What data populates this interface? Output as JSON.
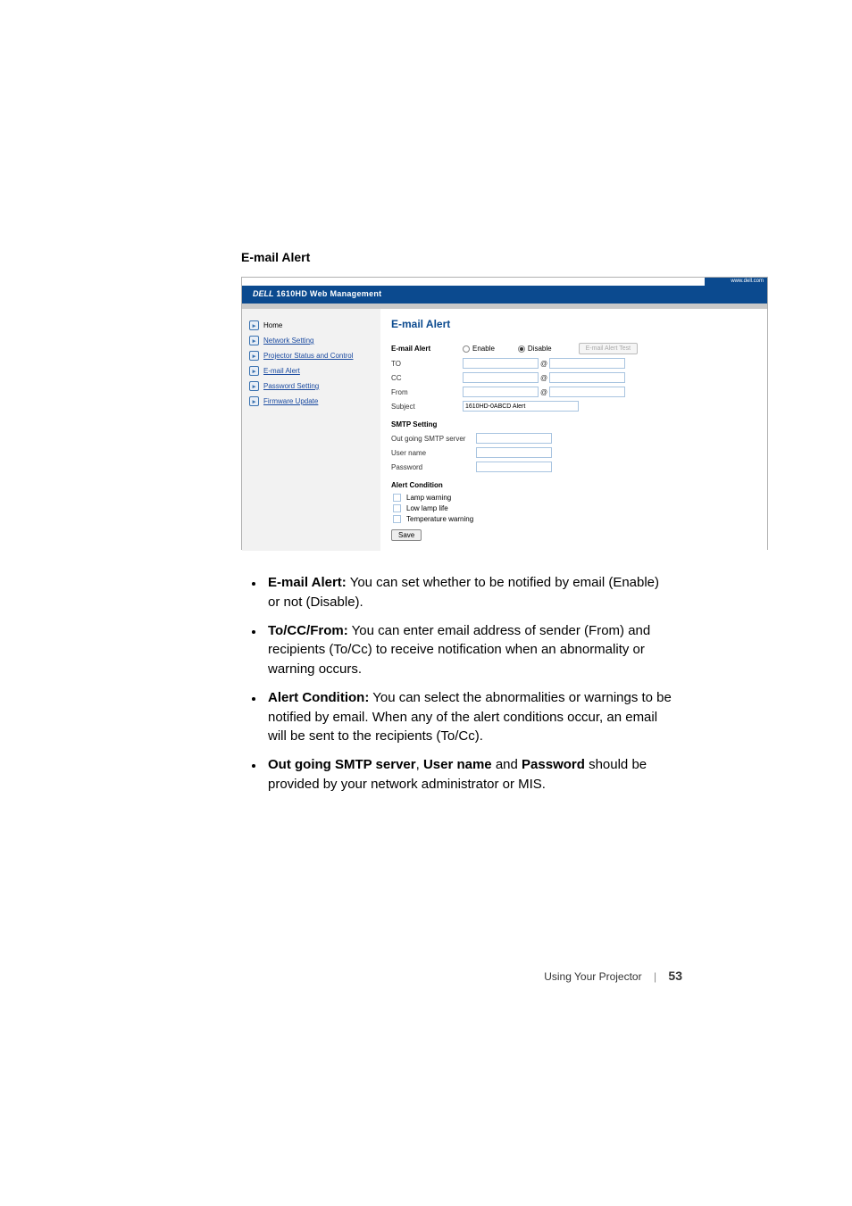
{
  "section_title": "E-mail Alert",
  "top_link": "www.dell.com",
  "header_brand": "DELL",
  "header_title": "1610HD Web Management",
  "nav": [
    {
      "label": "Home",
      "active": true
    },
    {
      "label": "Network Setting",
      "active": false
    },
    {
      "label": "Projector Status and Control",
      "active": false
    },
    {
      "label": "E-mail Alert",
      "active": false
    },
    {
      "label": "Password Setting",
      "active": false
    },
    {
      "label": "Firmware Update",
      "active": false
    }
  ],
  "panel": {
    "title": "E-mail Alert",
    "alert_label": "E-mail Alert",
    "enable": "Enable",
    "disable": "Disable",
    "test_btn": "E-mail Alert Test",
    "to": "TO",
    "cc": "CC",
    "from": "From",
    "subject": "Subject",
    "subject_value": "1610HD-0ABCD Alert",
    "smtp_head": "SMTP Setting",
    "smtp_server": "Out going SMTP server",
    "user": "User name",
    "pass": "Password",
    "cond_head": "Alert Condition",
    "c1": "Lamp warning",
    "c2": "Low lamp life",
    "c3": "Temperature warning",
    "save": "Save"
  },
  "bullets": [
    {
      "bold": "E-mail Alert:",
      "text": " You can set whether to be notified by email (Enable) or not (Disable)."
    },
    {
      "bold": "To/CC/From:",
      "text": " You can enter email address of sender (From) and recipients (To/Cc) to receive notification when an abnormality or warning occurs."
    },
    {
      "bold": "Alert Condition:",
      "text": " You can select the abnormalities or warnings to be notified by email. When any of the alert conditions occur, an email will be sent to the recipients (To/Cc)."
    }
  ],
  "bullet4_pre": "Out going SMTP server",
  "bullet4_mid1": ", ",
  "bullet4_b2": "User name",
  "bullet4_mid2": " and ",
  "bullet4_b3": "Password",
  "bullet4_tail": " should be provided by your network administrator or MIS.",
  "footer_label": "Using Your Projector",
  "footer_page": "53"
}
